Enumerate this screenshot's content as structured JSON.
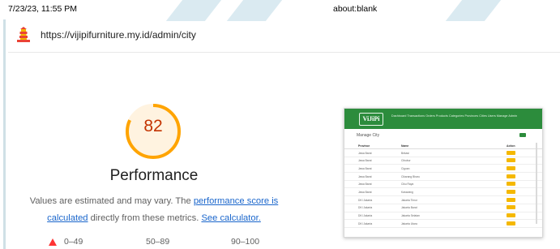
{
  "print_header": {
    "date": "7/23/23, 11:55 PM",
    "title": "about:blank"
  },
  "urlbar": {
    "url": "https://vijipifurniture.my.id/admin/city"
  },
  "gauge": {
    "score": "82",
    "fraction": 0.82,
    "color": "#ffa400",
    "text_color": "#c33300"
  },
  "performance": {
    "title": "Performance",
    "desc_pre": "Values are estimated and may vary. The ",
    "link1": "performance score is calculated",
    "desc_mid": " directly from these metrics. ",
    "link2": "See calculator."
  },
  "legend": {
    "fail": "0–49",
    "average": "50–89",
    "pass": "90–100"
  },
  "screenshot": {
    "brand": "ViJiPi",
    "menu": "Dashboard  Transactions  Orders  Products  Categories  Provinces  Cities  Users  Manage  Admin",
    "heading": "Manage City",
    "columns": [
      "Province",
      "Name",
      "Action"
    ],
    "rows": [
      [
        "Jawa Barat",
        "Bekasi"
      ],
      [
        "Jawa Barat",
        "Cibubur"
      ],
      [
        "Jawa Barat",
        "Cigoan"
      ],
      [
        "Jawa Barat",
        "Cikarang Bharu"
      ],
      [
        "Jawa Barat",
        "Ciku Raya"
      ],
      [
        "Jawa Barat",
        "Karawang"
      ],
      [
        "DKI Jakarta",
        "Jakarta Timur"
      ],
      [
        "DKI Jakarta",
        "Jakarta Barat"
      ],
      [
        "DKI Jakarta",
        "Jakarta Selatan"
      ],
      [
        "DKI Jakarta",
        "Jakarta Utara"
      ]
    ]
  }
}
